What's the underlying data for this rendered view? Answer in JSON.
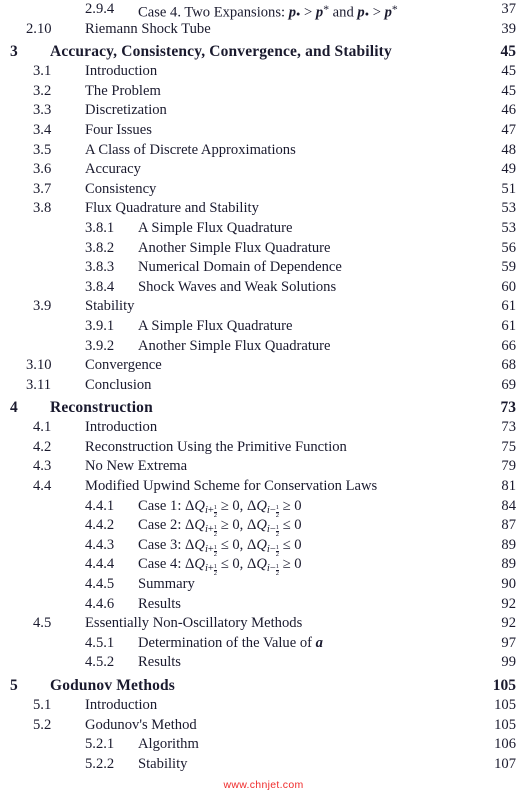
{
  "document": {
    "type": "table-of-contents",
    "watermark": "www.chnjet.com",
    "watermark_color": "#ef2b2b",
    "text_color": "#1a1a2e",
    "background_color": "#ffffff"
  },
  "entries": [
    {
      "level": "subsection",
      "number": "2.9.4",
      "title_html": "Case 4. Two Expansions: <span class=\"mbold\">p</span><span class=\"dotsub\">•</span> &gt; <span class=\"mbold\">p</span><span class=\"supstar\">*</span> and <span class=\"mbold\">p</span><span class=\"dotsub\">•</span> &gt; <span class=\"mbold\">p</span><span class=\"supstar\">*</span>",
      "title_text": "Case 4. Two Expansions: p• > p* and p• > p*",
      "page": "37"
    },
    {
      "level": "section",
      "number": "2.10",
      "title_text": "Riemann Shock Tube",
      "page": "39"
    },
    {
      "level": "chapter",
      "number": "3",
      "title_text": "Accuracy, Consistency, Convergence, and Stability",
      "page": "45"
    },
    {
      "level": "section",
      "number": "3.1",
      "title_text": "Introduction",
      "page": "45"
    },
    {
      "level": "section",
      "number": "3.2",
      "title_text": "The Problem",
      "page": "45"
    },
    {
      "level": "section",
      "number": "3.3",
      "title_text": "Discretization",
      "page": "46"
    },
    {
      "level": "section",
      "number": "3.4",
      "title_text": "Four Issues",
      "page": "47"
    },
    {
      "level": "section",
      "number": "3.5",
      "title_text": "A Class of Discrete Approximations",
      "page": "48"
    },
    {
      "level": "section",
      "number": "3.6",
      "title_text": "Accuracy",
      "page": "49"
    },
    {
      "level": "section",
      "number": "3.7",
      "title_text": "Consistency",
      "page": "51"
    },
    {
      "level": "section",
      "number": "3.8",
      "title_text": "Flux Quadrature and Stability",
      "page": "53"
    },
    {
      "level": "subsection",
      "number": "3.8.1",
      "title_text": "A Simple Flux Quadrature",
      "page": "53"
    },
    {
      "level": "subsection",
      "number": "3.8.2",
      "title_text": "Another Simple Flux Quadrature",
      "page": "56"
    },
    {
      "level": "subsection",
      "number": "3.8.3",
      "title_text": "Numerical Domain of Dependence",
      "page": "59"
    },
    {
      "level": "subsection",
      "number": "3.8.4",
      "title_text": "Shock Waves and Weak Solutions",
      "page": "60"
    },
    {
      "level": "section",
      "number": "3.9",
      "title_text": "Stability",
      "page": "61"
    },
    {
      "level": "subsection",
      "number": "3.9.1",
      "title_text": "A Simple Flux Quadrature",
      "page": "61"
    },
    {
      "level": "subsection",
      "number": "3.9.2",
      "title_text": "Another Simple Flux Quadrature",
      "page": "66"
    },
    {
      "level": "section",
      "number": "3.10",
      "title_text": "Convergence",
      "page": "68"
    },
    {
      "level": "section",
      "number": "3.11",
      "title_text": "Conclusion",
      "page": "69"
    },
    {
      "level": "chapter",
      "number": "4",
      "title_text": "Reconstruction",
      "page": "73"
    },
    {
      "level": "section",
      "number": "4.1",
      "title_text": "Introduction",
      "page": "73"
    },
    {
      "level": "section",
      "number": "4.2",
      "title_text": "Reconstruction Using the Primitive Function",
      "page": "75"
    },
    {
      "level": "section",
      "number": "4.3",
      "title_text": "No New Extrema",
      "page": "79"
    },
    {
      "level": "section",
      "number": "4.4",
      "title_text": "Modified Upwind Scheme for Conservation Laws",
      "page": "81"
    },
    {
      "level": "subsection",
      "number": "4.4.1",
      "title_html": "Case 1: &Delta;<span class=\"mathi\">Q</span><span class=\"sub\"><span class=\"mathi\">i</span>+<span class=\"frac\"><span class=\"n\">1</span><span class=\"b\">2</span></span></span> &ge; 0, &Delta;<span class=\"mathi\">Q</span><span class=\"sub\"><span class=\"mathi\">i</span>&minus;<span class=\"frac\"><span class=\"n\">1</span><span class=\"b\">2</span></span></span> &ge; 0",
      "title_text": "Case 1: ΔQ_{i+1/2} ≥ 0, ΔQ_{i-1/2} ≥ 0",
      "page": "84"
    },
    {
      "level": "subsection",
      "number": "4.4.2",
      "title_html": "Case 2: &Delta;<span class=\"mathi\">Q</span><span class=\"sub\"><span class=\"mathi\">i</span>+<span class=\"frac\"><span class=\"n\">1</span><span class=\"b\">2</span></span></span> &ge; 0, &Delta;<span class=\"mathi\">Q</span><span class=\"sub\"><span class=\"mathi\">i</span>&minus;<span class=\"frac\"><span class=\"n\">1</span><span class=\"b\">2</span></span></span> &le; 0",
      "title_text": "Case 2: ΔQ_{i+1/2} ≥ 0, ΔQ_{i-1/2} ≤ 0",
      "page": "87"
    },
    {
      "level": "subsection",
      "number": "4.4.3",
      "title_html": "Case 3: &Delta;<span class=\"mathi\">Q</span><span class=\"sub\"><span class=\"mathi\">i</span>+<span class=\"frac\"><span class=\"n\">1</span><span class=\"b\">2</span></span></span> &le; 0, &Delta;<span class=\"mathi\">Q</span><span class=\"sub\"><span class=\"mathi\">i</span>&minus;<span class=\"frac\"><span class=\"n\">1</span><span class=\"b\">2</span></span></span> &le; 0",
      "title_text": "Case 3: ΔQ_{i+1/2} ≤ 0, ΔQ_{i-1/2} ≤ 0",
      "page": "89"
    },
    {
      "level": "subsection",
      "number": "4.4.4",
      "title_html": "Case 4: &Delta;<span class=\"mathi\">Q</span><span class=\"sub\"><span class=\"mathi\">i</span>+<span class=\"frac\"><span class=\"n\">1</span><span class=\"b\">2</span></span></span> &le; 0, &Delta;<span class=\"mathi\">Q</span><span class=\"sub\"><span class=\"mathi\">i</span>&minus;<span class=\"frac\"><span class=\"n\">1</span><span class=\"b\">2</span></span></span> &ge; 0",
      "title_text": "Case 4: ΔQ_{i+1/2} ≤ 0, ΔQ_{i-1/2} ≥ 0",
      "page": "89"
    },
    {
      "level": "subsection",
      "number": "4.4.5",
      "title_text": "Summary",
      "page": "90"
    },
    {
      "level": "subsection",
      "number": "4.4.6",
      "title_text": "Results",
      "page": "92"
    },
    {
      "level": "section",
      "number": "4.5",
      "title_text": "Essentially Non-Oscillatory Methods",
      "page": "92"
    },
    {
      "level": "subsection",
      "number": "4.5.1",
      "title_html": "Determination of the Value of <span class=\"mbold\">a</span>",
      "title_text": "Determination of the Value of a",
      "page": "97"
    },
    {
      "level": "subsection",
      "number": "4.5.2",
      "title_text": "Results",
      "page": "99"
    },
    {
      "level": "chapter",
      "number": "5",
      "title_text": "Godunov Methods",
      "page": "105"
    },
    {
      "level": "section",
      "number": "5.1",
      "title_text": "Introduction",
      "page": "105"
    },
    {
      "level": "section",
      "number": "5.2",
      "title_text": "Godunov's Method",
      "page": "105"
    },
    {
      "level": "subsection",
      "number": "5.2.1",
      "title_text": "Algorithm",
      "page": "106"
    },
    {
      "level": "subsection",
      "number": "5.2.2",
      "title_text": "Stability",
      "page": "107"
    }
  ]
}
